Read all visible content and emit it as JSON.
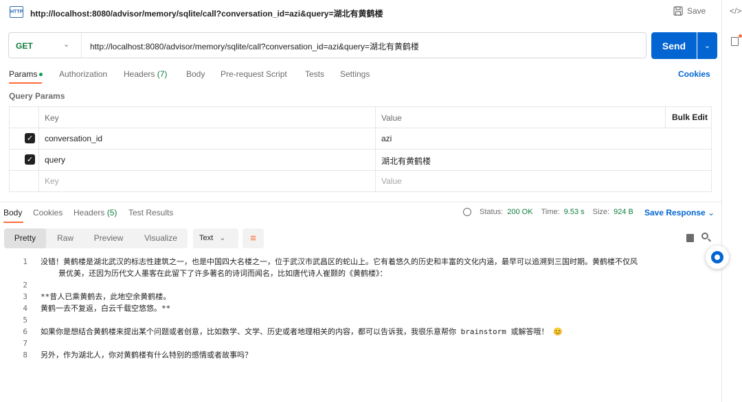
{
  "request": {
    "title": "http://localhost:8080/advisor/memory/sqlite/call?conversation_id=azi&query=湖北有黄鹤楼",
    "save_label": "Save",
    "method": "GET",
    "url": "http://localhost:8080/advisor/memory/sqlite/call?conversation_id=azi&query=湖北有黄鹤楼",
    "send_label": "Send"
  },
  "rail": {
    "code_label": "</>"
  },
  "tabs": {
    "params": "Params",
    "authorization": "Authorization",
    "headers": "Headers",
    "headers_count": "(7)",
    "body": "Body",
    "prerequest": "Pre-request Script",
    "tests": "Tests",
    "settings": "Settings",
    "cookies": "Cookies"
  },
  "query_params": {
    "title": "Query Params",
    "col_key": "Key",
    "col_value": "Value",
    "bulk_edit": "Bulk Edit",
    "rows": [
      {
        "key": "conversation_id",
        "value": "azi",
        "checked": true
      },
      {
        "key": "query",
        "value": "湖北有黄鹤楼",
        "checked": true
      }
    ],
    "key_placeholder": "Key",
    "value_placeholder": "Value"
  },
  "response": {
    "tabs": {
      "body": "Body",
      "cookies": "Cookies",
      "headers": "Headers",
      "headers_count": "(5)",
      "test_results": "Test Results"
    },
    "status_label": "Status:",
    "status_value": "200 OK",
    "time_label": "Time:",
    "time_value": "9.53 s",
    "size_label": "Size:",
    "size_value": "924 B",
    "save_response": "Save Response",
    "views": {
      "pretty": "Pretty",
      "raw": "Raw",
      "preview": "Preview",
      "visualize": "Visualize"
    },
    "format": "Text",
    "lines": [
      {
        "n": "1",
        "text": "没错！黄鹤楼是湖北武汉的标志性建筑之一，也是中国四大名楼之一，位于武汉市武昌区的蛇山上。它有着悠久的历史和丰富的文化内涵，最早可以追溯到三国时期。黄鹤楼不仅风"
      },
      {
        "n": "",
        "text": "景优美，还因为历代文人墨客在此留下了许多著名的诗词而闻名，比如唐代诗人崔颢的《黄鹤楼》："
      },
      {
        "n": "2",
        "text": ""
      },
      {
        "n": "3",
        "text": "**昔人已乘黄鹤去，此地空余黄鹤楼。"
      },
      {
        "n": "4",
        "text": "黄鹤一去不复返，白云千载空悠悠。**"
      },
      {
        "n": "5",
        "text": ""
      },
      {
        "n": "6",
        "text": "如果你是想结合黄鹤楼来提出某个问题或者创意，比如数学、文学、历史或者地理相关的内容，都可以告诉我，我很乐意帮你 brainstorm 或解答哦！ 😊"
      },
      {
        "n": "7",
        "text": ""
      },
      {
        "n": "8",
        "text": "另外，作为湖北人，你对黄鹤楼有什么特别的感情或者故事吗？"
      }
    ]
  },
  "colors": {
    "accent": "#ff6c37",
    "primary": "#0265d2",
    "success": "#0e7d3c"
  },
  "icons": [
    "http-request-icon",
    "save-icon",
    "code-icon",
    "info-panel-icon",
    "chevron-down-icon",
    "globe-icon",
    "wrap-lines-icon",
    "copy-icon",
    "search-icon",
    "assistant-icon"
  ]
}
